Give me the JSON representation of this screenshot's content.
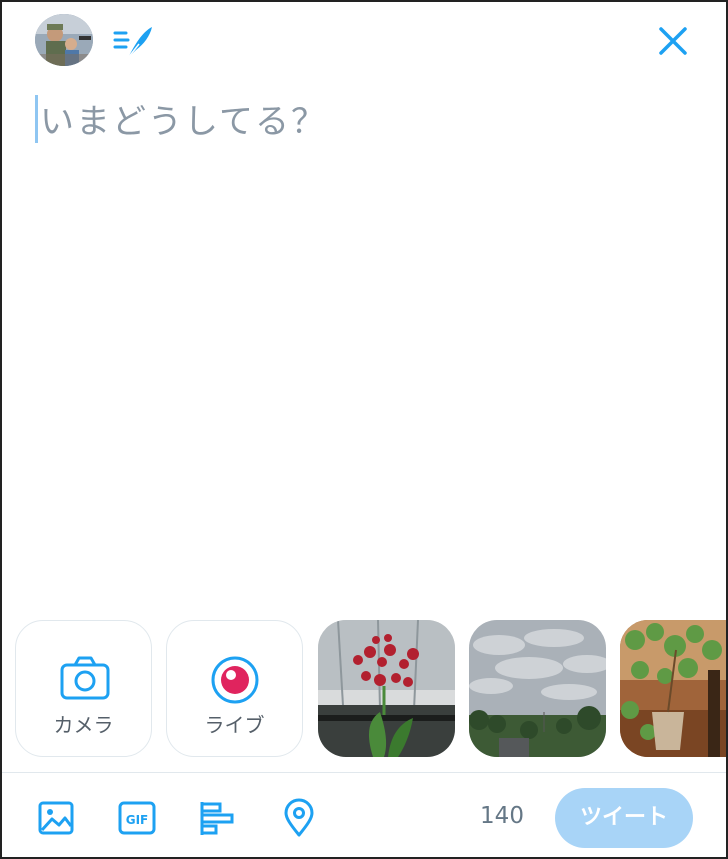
{
  "compose": {
    "placeholder": "いまどうしてる？"
  },
  "attachments": {
    "camera_label": "カメラ",
    "live_label": "ライブ"
  },
  "toolbar": {
    "char_count": "140",
    "tweet_label": "ツイート"
  },
  "icons": {
    "avatar": "avatar",
    "thread": "feather-icon",
    "close": "close-icon",
    "camera": "camera-icon",
    "live": "live-icon",
    "image": "image-icon",
    "gif": "gif-icon",
    "poll": "poll-icon",
    "location": "location-icon"
  },
  "colors": {
    "accent": "#1da1f2",
    "button_disabled": "#a8d4f7",
    "live": "#e0245e"
  }
}
